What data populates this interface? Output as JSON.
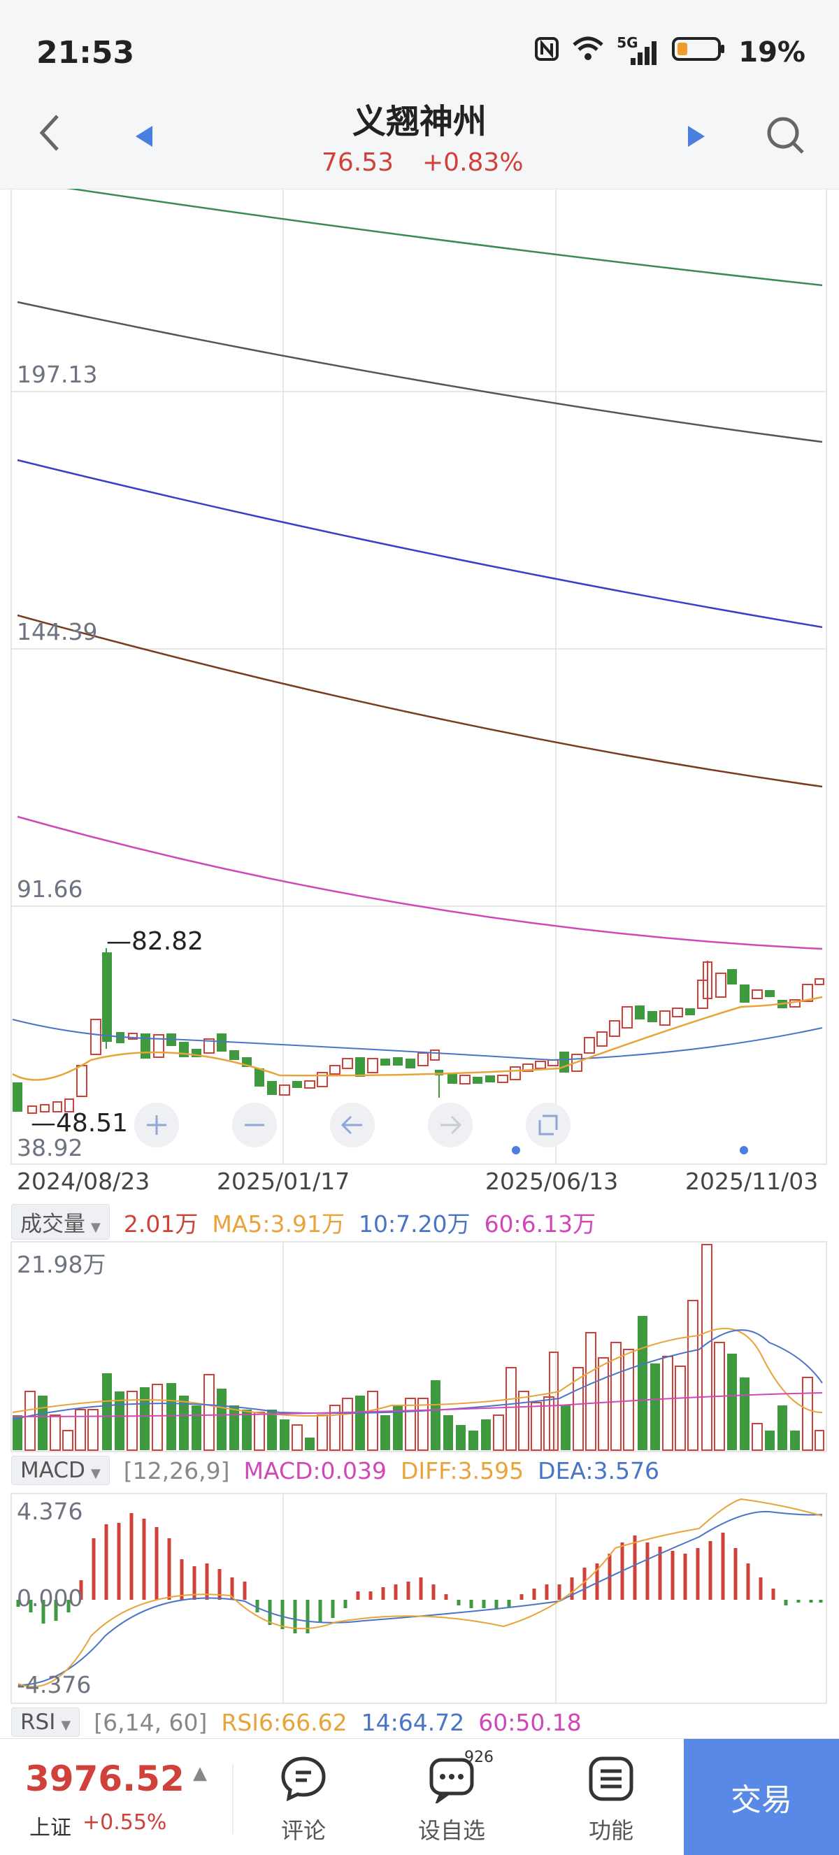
{
  "status_bar": {
    "time": "21:53",
    "network": "5G",
    "battery": "19%"
  },
  "header": {
    "title": "义翘神州",
    "price": "76.53",
    "change_pct": "+0.83%"
  },
  "colors": {
    "up": "#d0413a",
    "down": "#3f9a3f",
    "accent": "#5889e6"
  },
  "main_chart": {
    "price_levels": [
      "197.13",
      "144.39",
      "91.66",
      "38.92"
    ],
    "high_marker": "82.82",
    "low_marker": "48.51",
    "x_dates": [
      "2024/08/23",
      "2025/01/17",
      "2025/06/13",
      "2025/11/03"
    ],
    "controls": [
      "zoom-in",
      "zoom-out",
      "scroll-left",
      "scroll-right",
      "fullscreen"
    ]
  },
  "volume_panel": {
    "selector": "成交量",
    "values": {
      "vol": "2.01万",
      "ma5": "MA5:3.91万",
      "ma10": "10:7.20万",
      "ma60": "60:6.13万"
    },
    "max_label": "21.98万"
  },
  "macd_panel": {
    "selector": "MACD",
    "params": "[12,26,9]",
    "macd": "MACD:0.039",
    "diff": "DIFF:3.595",
    "dea": "DEA:3.576",
    "levels": [
      "4.376",
      "0.000",
      "-4.376"
    ]
  },
  "rsi_panel": {
    "selector": "RSI",
    "params": "[6,14, 60]",
    "rsi6": "RSI6:66.62",
    "rsi14": "14:64.72",
    "rsi60": "60:50.18"
  },
  "bottom_bar": {
    "index_value": "3976.52",
    "index_name": "上证",
    "index_pct": "+0.55%",
    "comment_label": "评论",
    "watchlist_label": "设自选",
    "watchlist_badge": "926",
    "function_label": "功能",
    "trade_label": "交易"
  }
}
